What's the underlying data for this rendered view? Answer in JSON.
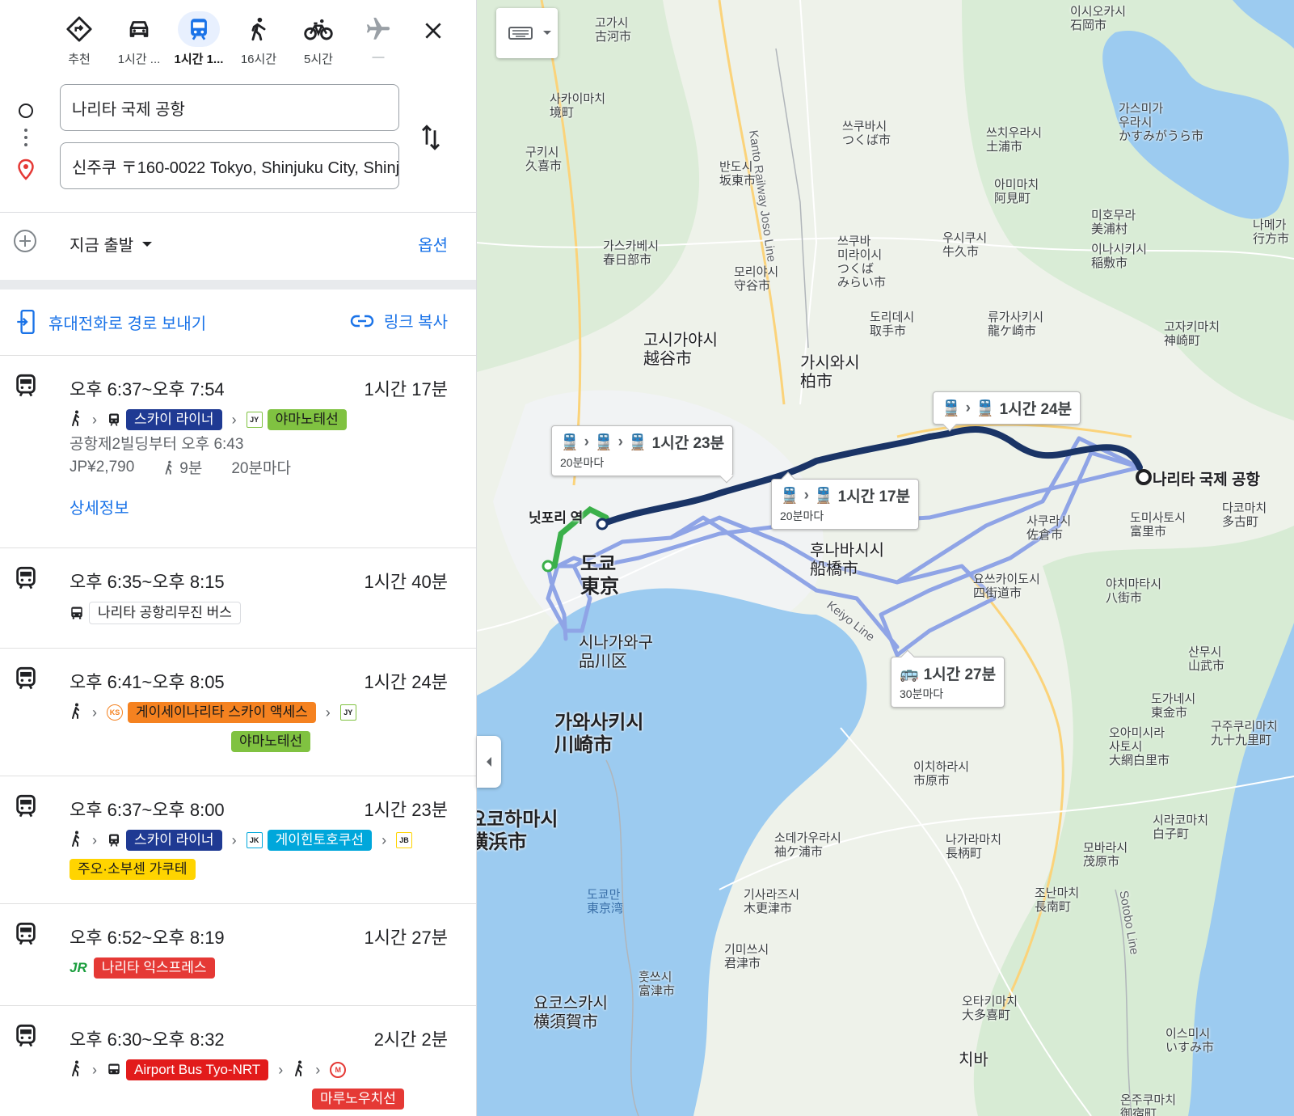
{
  "modes": [
    {
      "name": "recommended",
      "label": "추천",
      "icon": "directions-icon"
    },
    {
      "name": "drive",
      "label": "1시간 ...",
      "icon": "car-icon"
    },
    {
      "name": "transit",
      "label": "1시간 1...",
      "icon": "train-icon",
      "active": true
    },
    {
      "name": "walk",
      "label": "16시간",
      "icon": "walk-icon"
    },
    {
      "name": "bike",
      "label": "5시간",
      "icon": "bicycle-icon"
    },
    {
      "name": "flight",
      "label": "—",
      "icon": "airplane-icon"
    }
  ],
  "inputs": {
    "origin": "나리타 국제 공항",
    "destination": "신주쿠 〒160-0022 Tokyo, Shinjuku City, Shinjuku"
  },
  "depart": {
    "label": "지금 출발",
    "options_label": "옵션"
  },
  "share": {
    "send_to_phone": "휴대전화로 경로 보내기",
    "copy_link": "링크 복사"
  },
  "routes": [
    {
      "times": "오후 6:37~오후 7:54",
      "duration": "1시간 17분",
      "lines": [
        {
          "label": "스카이 라이너",
          "bg": "#1f3a93",
          "fg": "#ffffff"
        },
        {
          "code": "JY",
          "label": "야마노테선",
          "bg": "#80c241",
          "fg": "#1a1a1a"
        }
      ],
      "from": "공항제2빌딩부터 오후 6:43",
      "fare": "JP¥2,790",
      "walk": "9분",
      "freq": "20분마다",
      "details": "상세정보"
    },
    {
      "times": "오후 6:35~오후 8:15",
      "duration": "1시간 40분",
      "lines": [
        {
          "label": "나리타 공항리무진 버스"
        }
      ]
    },
    {
      "times": "오후 6:41~오후 8:05",
      "duration": "1시간 24분",
      "lines": [
        {
          "code": "KS",
          "label": "게이세이나리타 스카이 액세스",
          "bg": "#f58220",
          "fg": "#1a1a1a"
        },
        {
          "code": "JY",
          "label": "야마노테선",
          "bg": "#80c241",
          "fg": "#1a1a1a"
        }
      ]
    },
    {
      "times": "오후 6:37~오후 8:00",
      "duration": "1시간 23분",
      "lines": [
        {
          "label": "스카이 라이너",
          "bg": "#1f3a93",
          "fg": "#ffffff"
        },
        {
          "code": "JK",
          "label": "게이힌토호쿠선",
          "bg": "#00a7db",
          "fg": "#ffffff"
        },
        {
          "code": "JB",
          "label": "주오·소부센 가쿠테",
          "bg": "#ffd400",
          "fg": "#1a1a1a"
        }
      ]
    },
    {
      "times": "오후 6:52~오후 8:19",
      "duration": "1시간 27분",
      "lines": [
        {
          "code": "JR",
          "label": "나리타 익스프레스",
          "bg": "#e53935",
          "fg": "#ffffff"
        }
      ]
    },
    {
      "times": "오후 6:30~오후 8:32",
      "duration": "2시간 2분",
      "lines": [
        {
          "label": "Airport Bus Tyo-NRT",
          "bg": "#e21b1b",
          "fg": "#ffffff"
        },
        {
          "code": "M",
          "label": "마루노우치선",
          "bg": "#e53935",
          "fg": "#ffffff"
        }
      ]
    }
  ],
  "map": {
    "callouts": [
      {
        "main": "1시간 23분",
        "sub": "20분마다"
      },
      {
        "main": "1시간 24분",
        "sub": ""
      },
      {
        "main": "1시간 17분",
        "sub": "20분마다"
      },
      {
        "main": "1시간 27분",
        "sub": "30분마다"
      }
    ],
    "destination_label": "나리타 국제 공항",
    "station_label": "닛포리 역",
    "places": {
      "tokyo": "도쿄\n東京",
      "shinagawa": "시나가와구\n品川区",
      "kawasaki": "가와사키시\n川崎市",
      "yokohama": "요코하마시\n横浜市",
      "funabashi": "후나바시시\n船橋市",
      "kashiwa": "가시와시\n柏市",
      "koshigaya": "고시가야시\n越谷市",
      "kasukabe": "가스카베시\n春日部市",
      "moriya": "모리야시\n守谷市",
      "tsukubamirai": "쓰쿠바\n미라이시\nつくば\nみらい市",
      "toride": "도리데시\n取手市",
      "ryugasaki": "류가사키시\n龍ケ崎市",
      "ushiku": "우시쿠시\n牛久市",
      "tsukuba": "쓰쿠바시\nつくば市",
      "tsuchiura": "쓰치우라시\n土浦市",
      "ami": "아미마치\n阿見町",
      "kasumigaura": "가스미가\n우라시\nかすみがうら市",
      "miho": "미호무라\n美浦村",
      "inashiki": "이나시키시\n稲敷市",
      "kozaki": "고자키마치\n神崎町",
      "sakura": "사쿠라시\n佐倉市",
      "yotsukaido": "요쓰카이도시\n四街道市",
      "tomisato": "도미사토시\n富里市",
      "tako": "다코마치\n多古町",
      "yachimata": "야치마타시\n八街市",
      "sanmu": "산무시\n山武市",
      "togane": "도가네시\n東金市",
      "oamishirasato": "오아미시라\n사토시\n大網白里市",
      "kujukuri": "구주쿠리마치\n九十九里町",
      "ichihara": "이치하라시\n市原市",
      "sodegaura": "소데가우라시\n袖ケ浦市",
      "kisarazu": "기사라즈시\n木更津市",
      "kimitsu": "기미쓰시\n君津市",
      "futtsu": "훗쓰시\n富津市",
      "yokosuka": "요코스카시\n横須賀市",
      "nagara": "나가라마치\n長柄町",
      "mobara": "모바라시\n茂原市",
      "chonan": "조난마치\n長南町",
      "shirako": "시라코마치\n白子町",
      "otaki": "오타키마치\n大多喜町",
      "isumi": "이스미시\nいすみ市",
      "onjuku": "온주쿠마치\n御宿町",
      "chiba_pen": "치바",
      "tokyo_bay": "도쿄만\n東京湾",
      "koga": "고가시\n古河市",
      "sakai": "사카이마치\n境町",
      "kuki": "구키시\n久喜市",
      "bando": "반도시\n坂東市",
      "ishioka": "이시오카시\n石岡市",
      "namegata": "나메가\n行方市"
    },
    "roads": {
      "keiyo": "Keiyo Line",
      "kanto": "Kanto Railway Joso Line",
      "sotobo": "Sotobo Line"
    }
  }
}
